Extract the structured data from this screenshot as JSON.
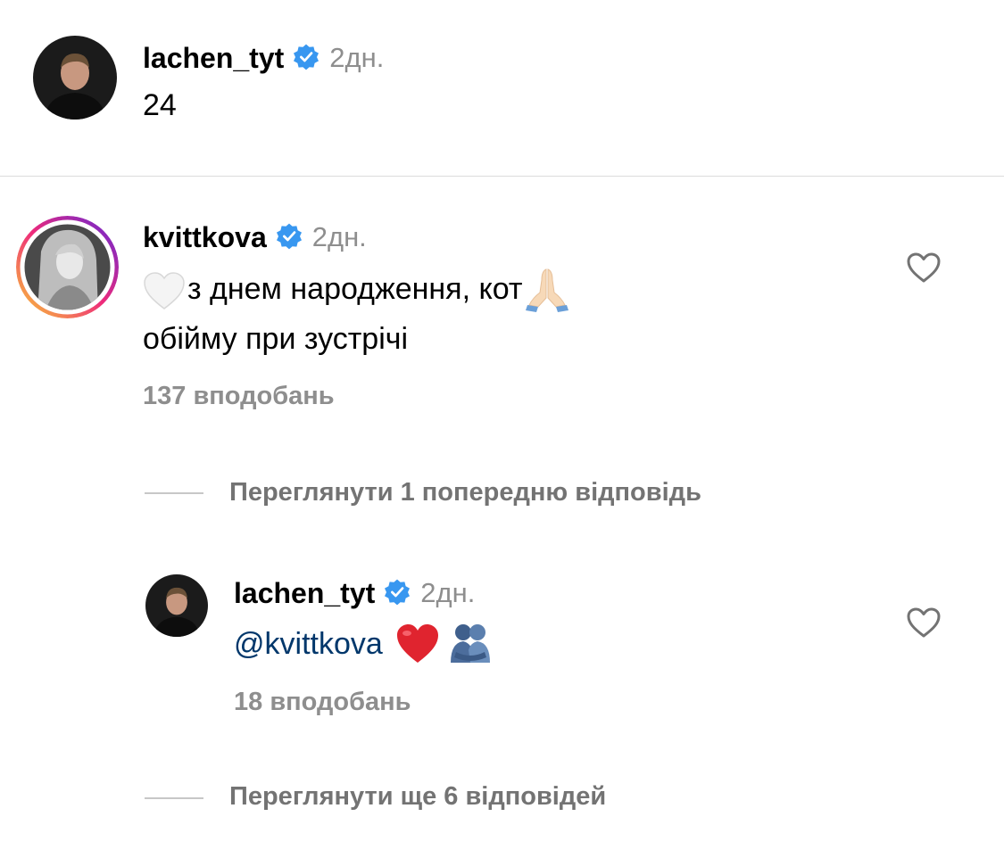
{
  "post": {
    "username": "lachen_tyt",
    "time": "2дн.",
    "caption": "24"
  },
  "comment": {
    "username": "kvittkova",
    "time": "2дн.",
    "line1": "з днем народження, кот",
    "line2": "обійму при зустрічі",
    "likes": "137 вподобань"
  },
  "view_previous": "Переглянути 1 попередню відповідь",
  "reply": {
    "username": "lachen_tyt",
    "time": "2дн.",
    "mention": "@kvittkova",
    "likes": "18 вподобань"
  },
  "view_more": "Переглянути ще 6 відповідей",
  "colors": {
    "verified": "#3897f0",
    "muted": "#8e8e8e",
    "mention": "#00376b",
    "heart": "#e0242f",
    "story_ring": [
      "#f9ce34",
      "#ee2a7b",
      "#6228d7"
    ]
  },
  "icons": [
    "verified-badge-icon",
    "heart-outline-icon",
    "white-heart-emoji",
    "praying-hands-emoji",
    "red-heart-emoji",
    "hugging-people-emoji"
  ]
}
